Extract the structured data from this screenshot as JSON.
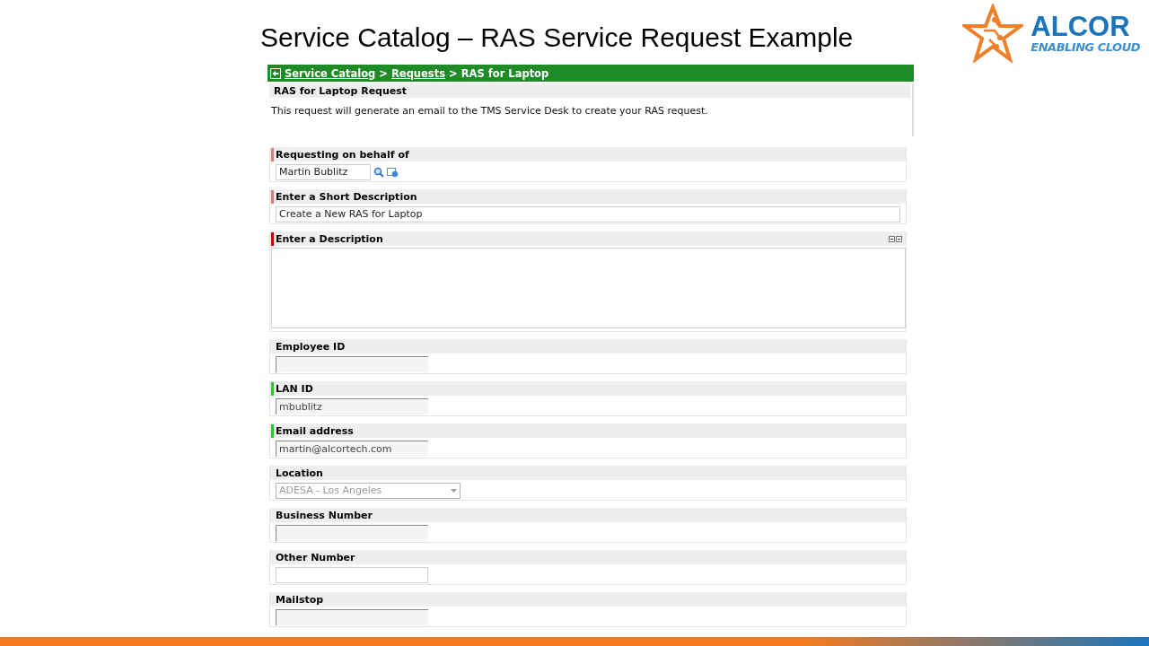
{
  "slide": {
    "title": "Service Catalog – RAS Service Request Example",
    "logo": {
      "name": "ALCOR",
      "tagline": "ENABLING CLOUD"
    }
  },
  "breadcrumb": [
    {
      "label": "Service Catalog",
      "link": true
    },
    {
      "label": ">",
      "link": false
    },
    {
      "label": "Requests",
      "link": true
    },
    {
      "label": "> RAS for Laptop",
      "link": false
    }
  ],
  "request": {
    "title": "RAS for Laptop Request",
    "description": "This request will generate an email to the TMS Service Desk to create your RAS request."
  },
  "fields": [
    {
      "label": "Requesting on behalf of",
      "kind": "lookup",
      "value": "Martin Bublitz",
      "readonly": false,
      "color": "#d77b7b"
    },
    {
      "label": "Enter a Short Description",
      "kind": "text",
      "value": "Create a New RAS for Laptop",
      "readonly": false,
      "color": "#d77b7b"
    },
    {
      "label": "Enter a Description",
      "kind": "textarea",
      "color": "#cc0000"
    },
    {
      "label": "Employee ID",
      "kind": "short",
      "readonly": true
    },
    {
      "label": "LAN ID",
      "kind": "short",
      "value": "mbublitz",
      "readonly": true,
      "color": "#22cc22"
    },
    {
      "label": "Email address",
      "kind": "short",
      "value": "martin@alcortech.com",
      "readonly": true,
      "color": "#22cc22"
    },
    {
      "label": "Location",
      "kind": "select",
      "value": "ADESA - Los Angeles",
      "readonly": true
    },
    {
      "label": "Business Number",
      "kind": "short",
      "readonly": true
    },
    {
      "label": "Other Number",
      "kind": "short",
      "readonly": false
    },
    {
      "label": "Mailstop",
      "kind": "short",
      "readonly": true
    }
  ]
}
